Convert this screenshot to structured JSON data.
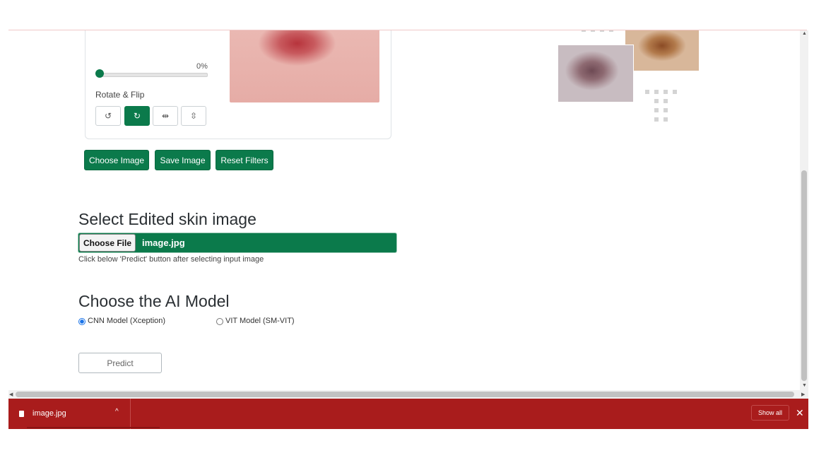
{
  "editor": {
    "brightness_percent": "0%",
    "slider_value": 0,
    "rotate_flip_label": "Rotate & Flip",
    "rotate_buttons": [
      {
        "icon": "rotate-left-icon",
        "glyph": "↺"
      },
      {
        "icon": "rotate-right-icon",
        "glyph": "↻"
      },
      {
        "icon": "flip-horizontal-icon",
        "glyph": "⇹"
      },
      {
        "icon": "flip-vertical-icon",
        "glyph": "⇳"
      }
    ]
  },
  "actions": {
    "choose_image": "Choose Image",
    "save_image": "Save Image",
    "reset_filters": "Reset Filters"
  },
  "select_section": {
    "heading": "Select Edited skin image",
    "choose_file_label": "Choose File",
    "file_name": "image.jpg",
    "hint": "Click below 'Predict' button after selecting input image"
  },
  "model_section": {
    "heading": "Choose the AI Model",
    "options": [
      {
        "label": "CNN Model (Xception)",
        "checked": true
      },
      {
        "label": "VIT Model (SM-VIT)",
        "checked": false
      }
    ],
    "predict_label": "Predict"
  },
  "download_bar": {
    "file_name": "image.jpg",
    "show_all": "Show all",
    "close_glyph": "✕",
    "chevron_glyph": "^"
  },
  "colors": {
    "accent": "#0b7a4b",
    "download_bar": "#a91c1c"
  }
}
